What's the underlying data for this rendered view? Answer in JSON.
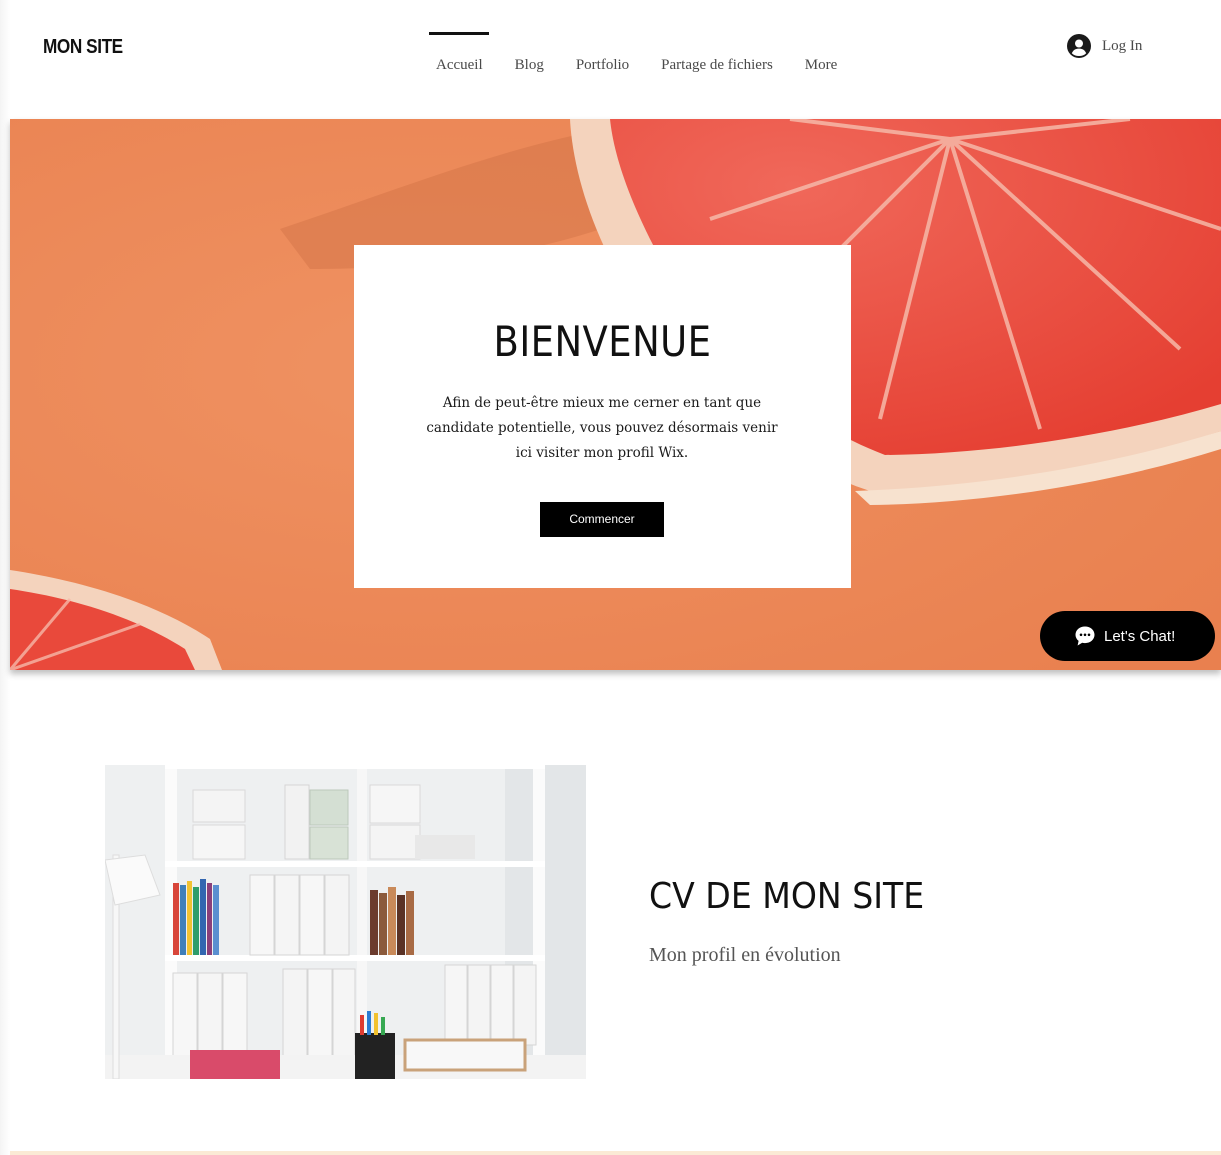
{
  "header": {
    "logo": "MON SITE",
    "nav": [
      {
        "label": "Accueil",
        "active": true
      },
      {
        "label": "Blog",
        "active": false
      },
      {
        "label": "Portfolio",
        "active": false
      },
      {
        "label": "Partage de fichiers",
        "active": false
      },
      {
        "label": "More",
        "active": false
      }
    ],
    "login_label": "Log In",
    "login_icon": "user-avatar-icon"
  },
  "hero": {
    "title": "BIENVENUE",
    "text": "Afin de peut-être mieux me cerner en tant que candidate potentielle, vous pouvez désormais venir ici visiter mon profil Wix.",
    "button_label": "Commencer",
    "background_color": "#ec8a58"
  },
  "chat": {
    "label": "Let's Chat!",
    "icon": "chat-bubble-icon"
  },
  "cv_section": {
    "title": "CV DE MON SITE",
    "subtitle": "Mon profil en évolution"
  },
  "colors": {
    "accent": "#000000",
    "text": "#111111",
    "hero_orange": "#ec8a58",
    "grapefruit_red": "#e8443a",
    "footer_strip": "#fbead5"
  }
}
